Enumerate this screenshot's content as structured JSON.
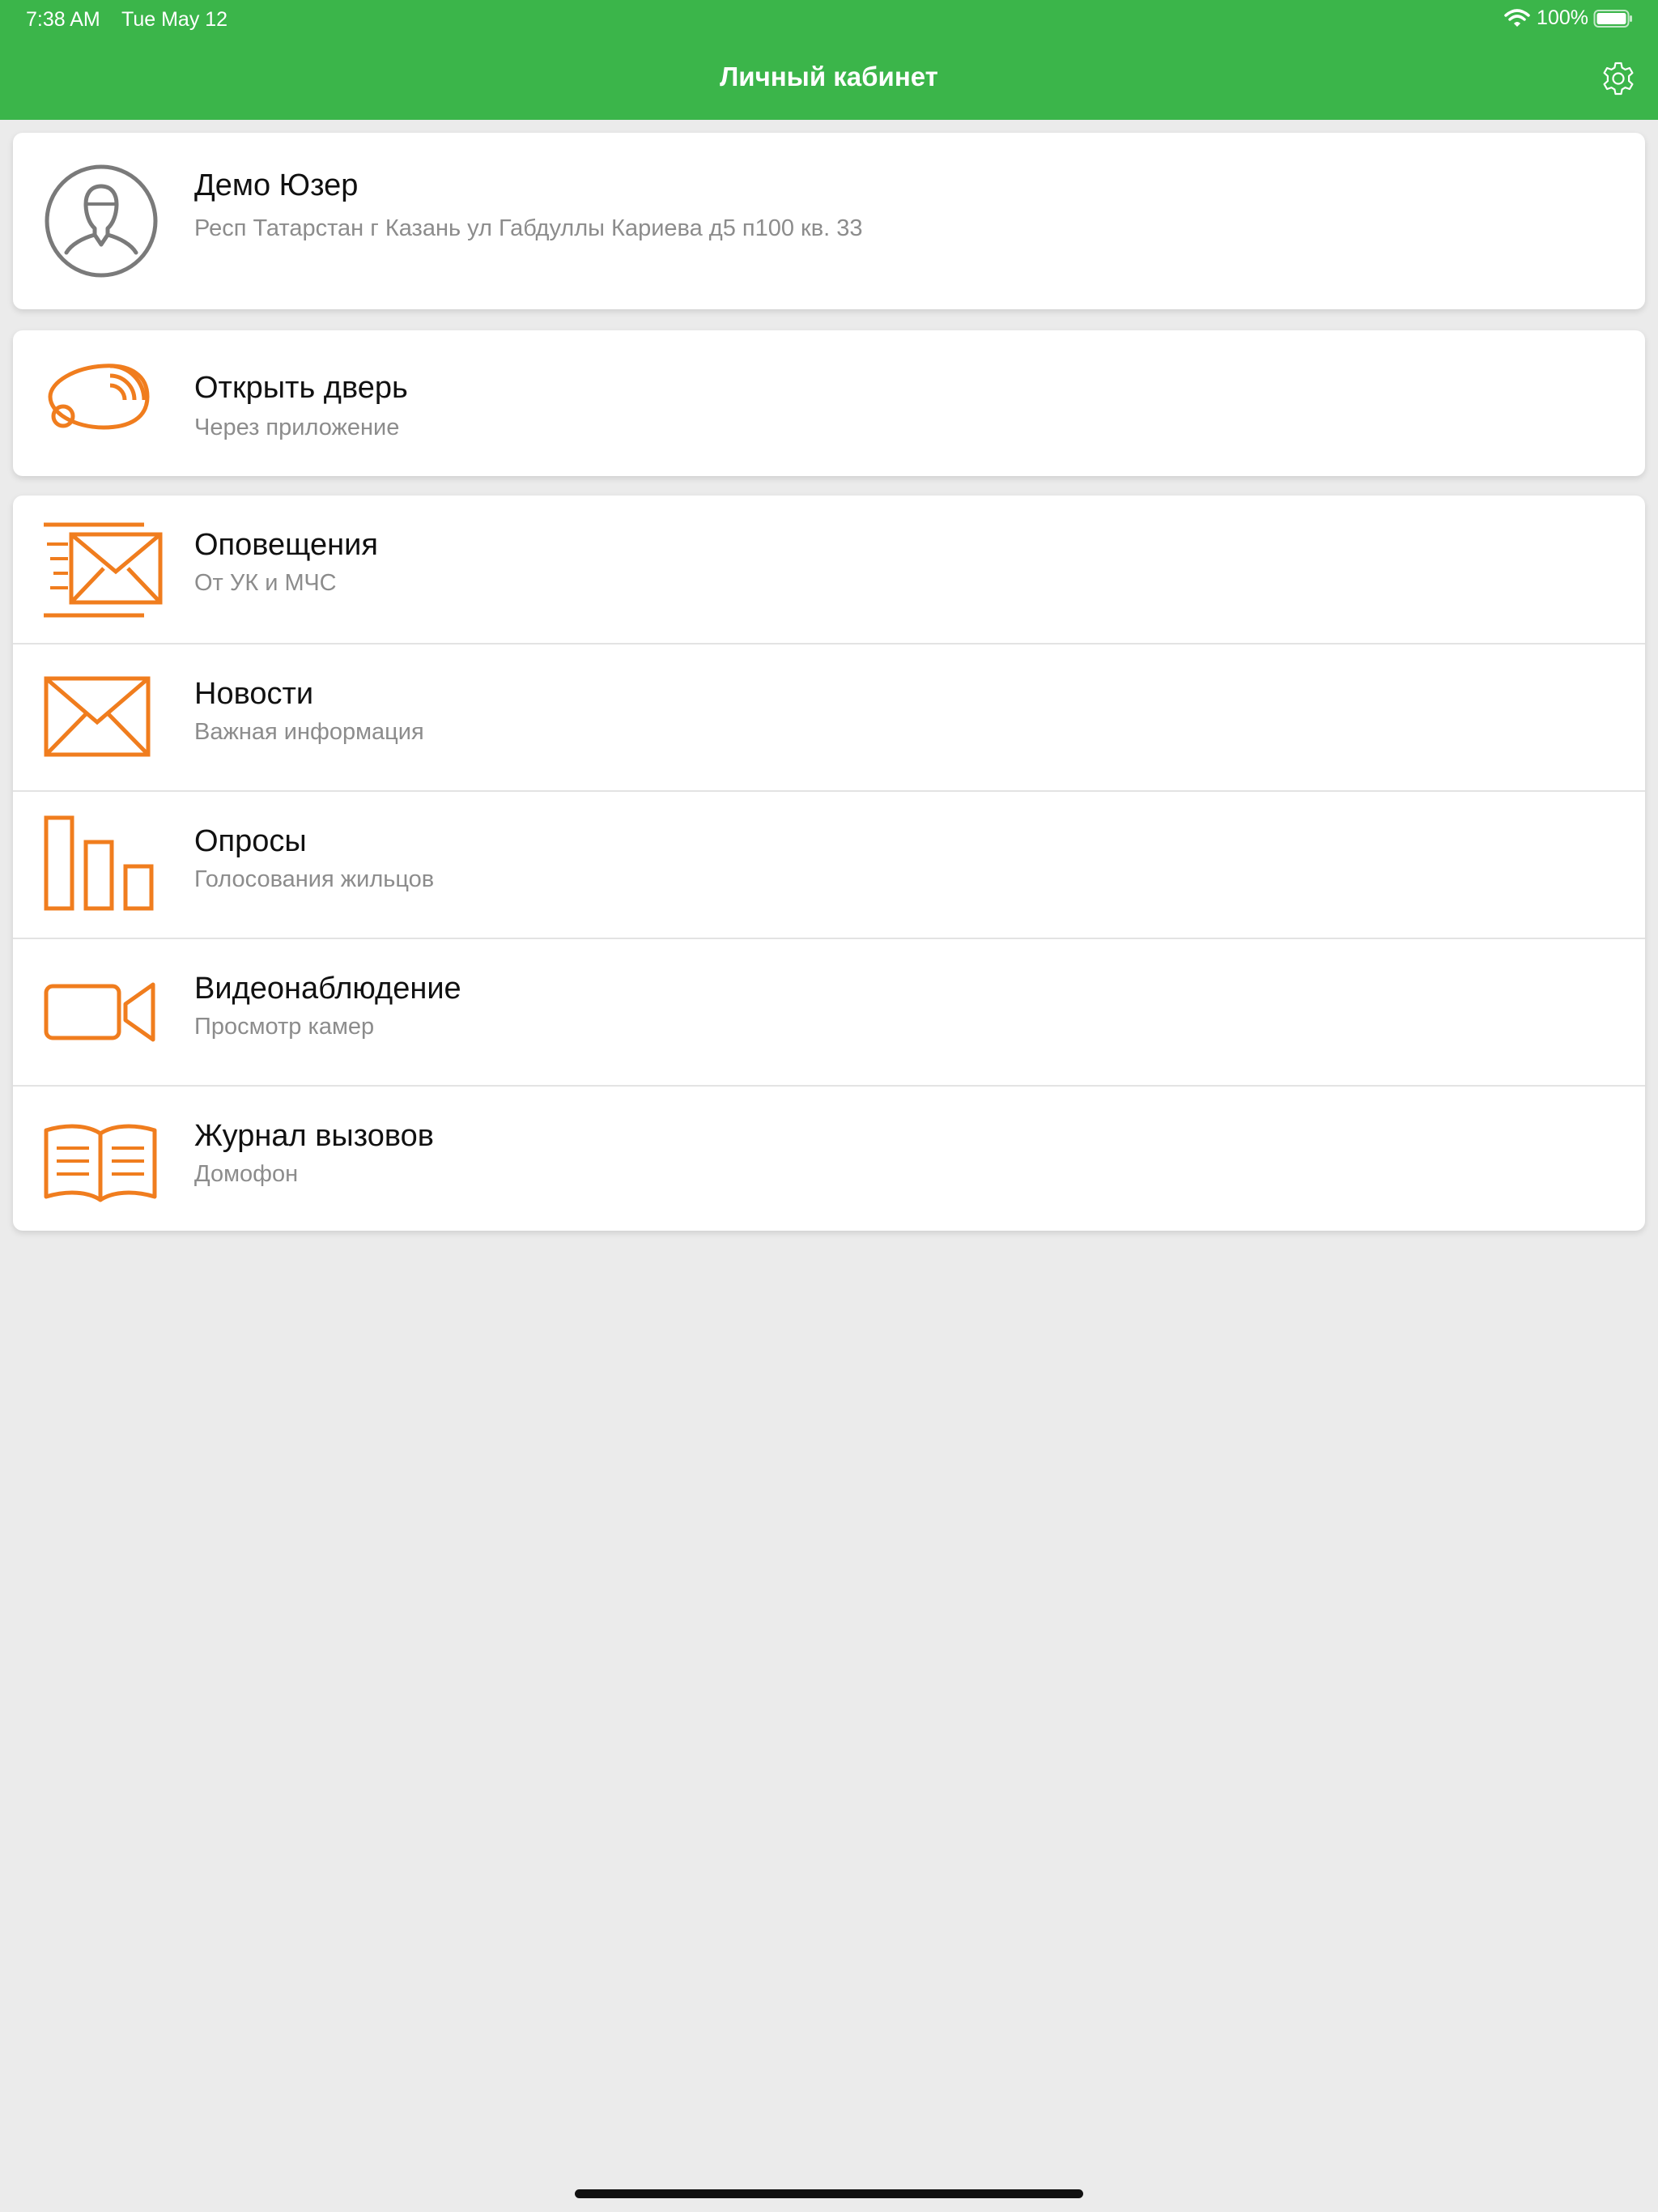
{
  "status_bar": {
    "time": "7:38 AM",
    "date": "Tue May 12",
    "battery": "100%"
  },
  "nav": {
    "title": "Личный кабинет"
  },
  "profile": {
    "name": "Демо Юзер",
    "address": "Респ Татарстан г Казань ул Габдуллы Кариева д5 п100 кв. 33"
  },
  "door": {
    "title": "Открыть дверь",
    "subtitle": "Через приложение"
  },
  "menu": [
    {
      "title": "Оповещения",
      "subtitle": "От УК и МЧС",
      "icon": "alert-envelope-icon"
    },
    {
      "title": "Новости",
      "subtitle": "Важная информация",
      "icon": "envelope-icon"
    },
    {
      "title": "Опросы",
      "subtitle": "Голосования жильцов",
      "icon": "bar-chart-icon"
    },
    {
      "title": "Видеонаблюдение",
      "subtitle": "Просмотр камер",
      "icon": "video-camera-icon"
    },
    {
      "title": "Журнал вызовов",
      "subtitle": "Домофон",
      "icon": "book-icon"
    }
  ],
  "colors": {
    "header": "#3bb54a",
    "accent": "#f07d1e",
    "background": "#ebebeb"
  }
}
